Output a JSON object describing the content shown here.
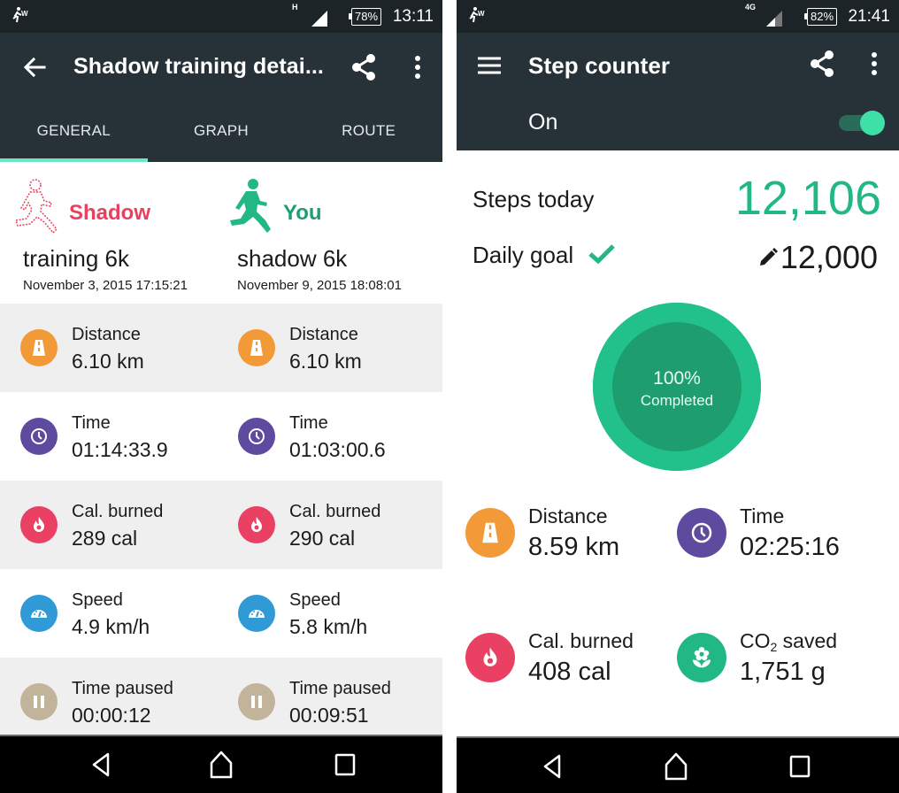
{
  "left": {
    "status_bar": {
      "network_type": "H",
      "battery": "78%",
      "time": "13:11"
    },
    "app_bar": {
      "title": "Shadow training detai...",
      "back_icon": "arrow-left-icon",
      "share_icon": "share-icon",
      "more_icon": "more-vert-icon"
    },
    "tabs": [
      {
        "label": "GENERAL",
        "active": true
      },
      {
        "label": "GRAPH",
        "active": false
      },
      {
        "label": "ROUTE",
        "active": false
      }
    ],
    "shadow": {
      "label": "Shadow",
      "name": "training 6k",
      "date": "November 3, 2015 17:15:21",
      "color": "#e8405e"
    },
    "you": {
      "label": "You",
      "name": "shadow 6k",
      "date": "November 9, 2015 18:08:01",
      "color": "#1f9e72"
    },
    "stats": [
      {
        "label": "Distance",
        "shadow": "6.10 km",
        "you": "6.10 km",
        "icon": "road-icon",
        "color": "#f29a38"
      },
      {
        "label": "Time",
        "shadow": "01:14:33.9",
        "you": "01:03:00.6",
        "icon": "clock-icon",
        "color": "#5e4a9e"
      },
      {
        "label": "Cal. burned",
        "shadow": "289 cal",
        "you": "290 cal",
        "icon": "flame-icon",
        "color": "#ea4063"
      },
      {
        "label": "Speed",
        "shadow": "4.9 km/h",
        "you": "5.8 km/h",
        "icon": "speedometer-icon",
        "color": "#2f9ad6"
      },
      {
        "label": "Time paused",
        "shadow": "00:00:12",
        "you": "00:09:51",
        "icon": "pause-icon",
        "color": "#c2b49a"
      }
    ]
  },
  "right": {
    "status_bar": {
      "network_type": "4G",
      "battery": "82%",
      "time": "21:41"
    },
    "app_bar": {
      "title": "Step counter",
      "menu_icon": "hamburger-menu-icon",
      "share_icon": "share-icon",
      "more_icon": "more-vert-icon",
      "toggle_label": "On",
      "toggle_on": true
    },
    "steps_today_label": "Steps today",
    "steps_today_value": "12,106",
    "daily_goal_label": "Daily goal",
    "daily_goal_value": "12,000",
    "progress": {
      "percent": 100,
      "percent_text": "100%",
      "caption": "Completed"
    },
    "stats": [
      {
        "label": "Distance",
        "value": "8.59 km",
        "icon": "road-icon",
        "color": "#f29a38"
      },
      {
        "label": "Time",
        "value": "02:25:16",
        "icon": "clock-icon",
        "color": "#5e4a9e"
      },
      {
        "label": "Cal. burned",
        "value": "408 cal",
        "icon": "flame-icon",
        "color": "#ea4063"
      },
      {
        "label_main": "CO",
        "label_sub": "2",
        "label_rest": " saved",
        "value": "1,751 g",
        "icon": "flower-icon",
        "color": "#22b886"
      }
    ],
    "accent": "#22b886"
  },
  "navbar": {
    "back": "back-triangle-icon",
    "home": "home-icon",
    "recents": "recents-square-icon"
  }
}
